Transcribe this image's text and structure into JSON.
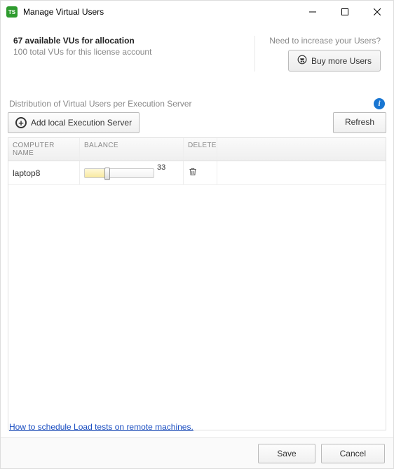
{
  "window": {
    "title": "Manage Virtual Users"
  },
  "summary": {
    "available": "67 available VUs for allocation",
    "total": "100 total VUs for this license account",
    "need_prompt": "Need to increase your Users?",
    "buy_label": "Buy more Users"
  },
  "section": {
    "label": "Distribution of Virtual Users per Execution Server"
  },
  "toolbar": {
    "add_label": "Add local Execution Server",
    "refresh_label": "Refresh"
  },
  "columns": {
    "name": "COMPUTER NAME",
    "balance": "BALANCE",
    "delete": "DELETE"
  },
  "rows": [
    {
      "name": "laptop8",
      "balance": 33
    }
  ],
  "help_link": "How to schedule Load tests on remote machines.",
  "footer": {
    "save": "Save",
    "cancel": "Cancel"
  }
}
